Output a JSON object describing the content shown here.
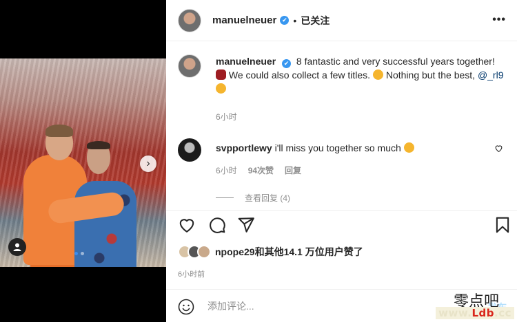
{
  "post": {
    "next_symbol": "›"
  },
  "header": {
    "username": "manuelneuer",
    "verified_mark": "✔",
    "separator": "•",
    "follow_label": "已关注",
    "more_label": "•••"
  },
  "caption": {
    "username": "manuelneuer",
    "text_1": "8 fantastic and very successful years together!",
    "text_2": "We could also collect a few titles.",
    "text_3": "Nothing but the best,",
    "mention": "@_rl9",
    "time": "6小时"
  },
  "comment": {
    "username": "svpportlewy",
    "text": "i'll miss you together so much",
    "time": "6小时",
    "likes": "94次赞",
    "reply_label": "回复",
    "view_replies_label": "查看回复 (4)"
  },
  "likes": {
    "text": "npope29和其他14.1 万位用户赞了"
  },
  "post_time": "6小时前",
  "add_comment": {
    "placeholder": "添加评论...",
    "post_label": "发布"
  },
  "watermark": {
    "cn": "零点吧",
    "url_prefix": "www.",
    "url_brand": "Ldb",
    "url_suffix": ".cc"
  },
  "colors": {
    "link": "#00376b",
    "verified": "#3897f0",
    "post_button": "#b2dffc"
  }
}
